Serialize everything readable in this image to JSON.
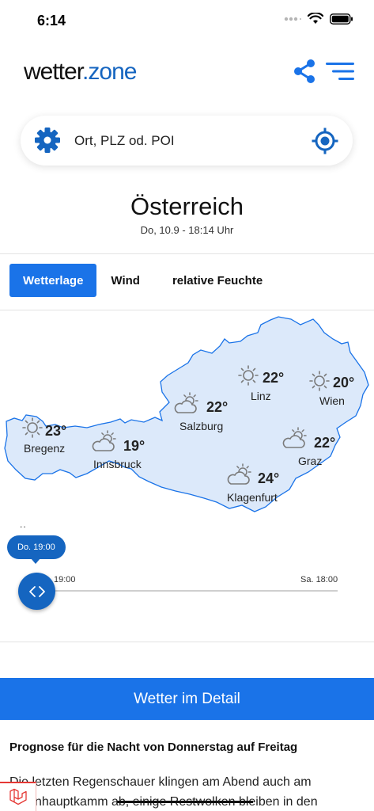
{
  "status_bar": {
    "time": "6:14"
  },
  "header": {
    "logo_part1": "wetter",
    "logo_part2": ".zone"
  },
  "search": {
    "placeholder": "Ort, PLZ od. POI"
  },
  "region": {
    "title": "Österreich",
    "date": "Do, 10.9 - 18:14 Uhr"
  },
  "tabs": [
    {
      "label": "Wetterlage",
      "active": true
    },
    {
      "label": "Wind",
      "active": false
    },
    {
      "label": "relative Feuchte",
      "active": false
    }
  ],
  "cities": [
    {
      "name": "Bregenz",
      "temp": "23°",
      "icon": "sunny"
    },
    {
      "name": "Innsbruck",
      "temp": "19°",
      "icon": "partly-cloudy"
    },
    {
      "name": "Salzburg",
      "temp": "22°",
      "icon": "partly-cloudy"
    },
    {
      "name": "Linz",
      "temp": "22°",
      "icon": "sunny"
    },
    {
      "name": "Wien",
      "temp": "20°",
      "icon": "sunny"
    },
    {
      "name": "Graz",
      "temp": "22°",
      "icon": "partly-cloudy"
    },
    {
      "name": "Klagenfurt",
      "temp": "24°",
      "icon": "partly-cloudy"
    }
  ],
  "timeline": {
    "dots": "..",
    "current": "Do. 19:00",
    "start_label": "19:00",
    "end_label": "Sa. 18:00"
  },
  "detail_button": "Wetter im Detail",
  "forecast": {
    "heading": "Prognose für die Nacht von Donnerstag auf Freitag",
    "line1": "Die letzten Regenschauer klingen am Abend auch am",
    "line2": "Alpenhauptkamm ab, einige Restwolken bleiben in den"
  },
  "colors": {
    "primary": "#1a73e8",
    "brand": "#1565c0",
    "map_fill": "#dce9fa",
    "map_border": "#1a73e8",
    "icon_gray": "#7a7a7a"
  }
}
